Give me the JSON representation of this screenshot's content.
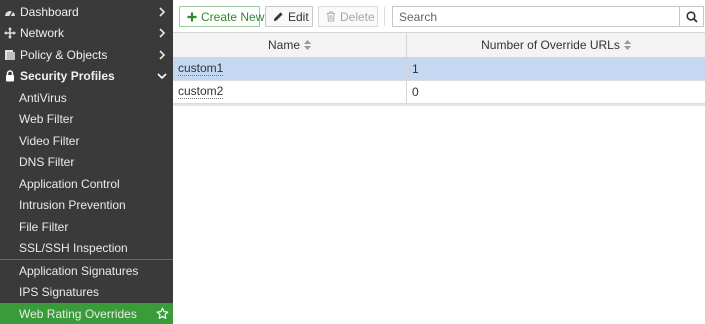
{
  "sidebar": {
    "top_items": [
      {
        "label": "Dashboard",
        "icon": "dashboard-icon"
      },
      {
        "label": "Network",
        "icon": "network-icon"
      },
      {
        "label": "Policy & Objects",
        "icon": "policy-icon"
      },
      {
        "label": "Security Profiles",
        "icon": "lock-icon"
      }
    ],
    "sub_items": [
      {
        "label": "AntiVirus"
      },
      {
        "label": "Web Filter"
      },
      {
        "label": "Video Filter"
      },
      {
        "label": "DNS Filter"
      },
      {
        "label": "Application Control"
      },
      {
        "label": "Intrusion Prevention"
      },
      {
        "label": "File Filter"
      },
      {
        "label": "SSL/SSH Inspection"
      },
      {
        "label": "Application Signatures"
      },
      {
        "label": "IPS Signatures"
      },
      {
        "label": "Web Rating Overrides"
      }
    ],
    "active_item": "Web Rating Overrides",
    "colors": {
      "background": "#3a3a3a",
      "active": "#3a9b3a"
    }
  },
  "toolbar": {
    "create_label": "Create New",
    "edit_label": "Edit",
    "delete_label": "Delete",
    "search_placeholder": "Search"
  },
  "table": {
    "columns": [
      "Name",
      "Number of Override URLs"
    ],
    "rows": [
      {
        "name": "custom1",
        "count": "1",
        "selected": true
      },
      {
        "name": "custom2",
        "count": "0",
        "selected": false
      }
    ],
    "colors": {
      "selected_row": "#c5d8f2"
    }
  }
}
